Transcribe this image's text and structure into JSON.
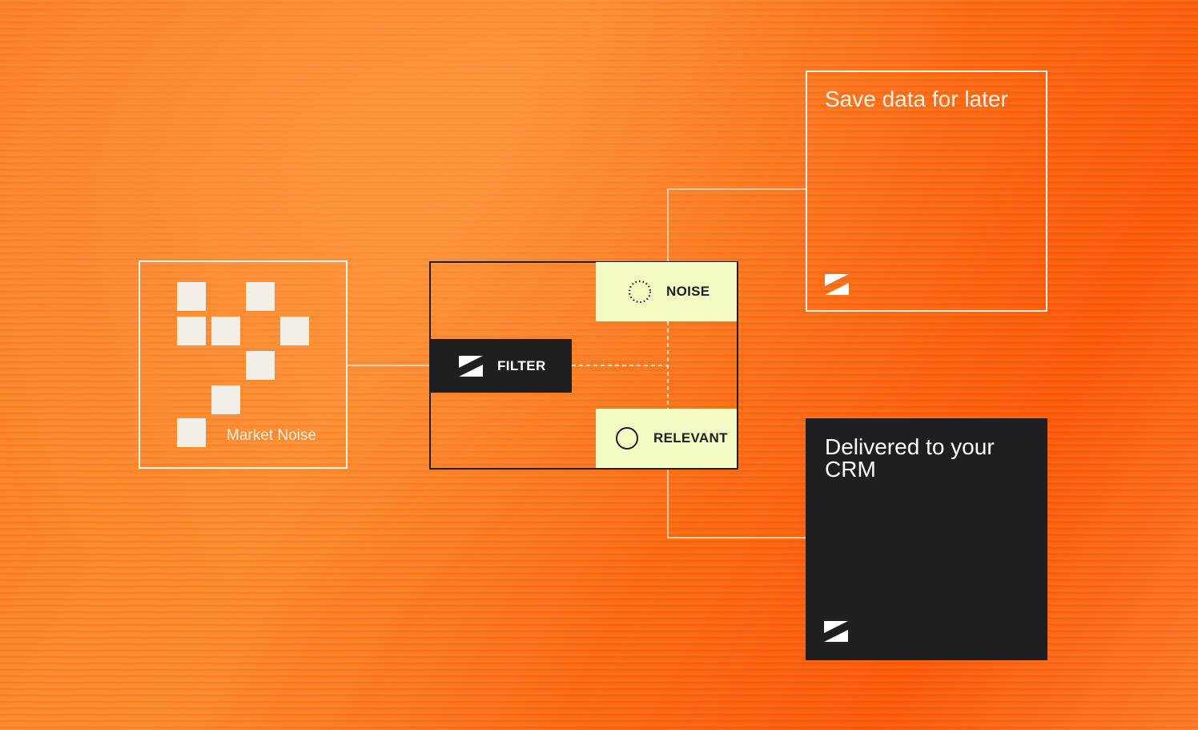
{
  "colors": {
    "background": "#ff7a1f",
    "dark": "#1f1f21",
    "pill": "#f5f9c4",
    "outline": "#ffffff",
    "square": "#f3eee6"
  },
  "source": {
    "label": "Market Noise"
  },
  "filter": {
    "label": "FILTER",
    "icon": "logo-icon"
  },
  "outputs": {
    "noise": {
      "label": "NOISE",
      "icon": "dotted-circle-icon"
    },
    "relevant": {
      "label": "RELEVANT",
      "icon": "circle-icon"
    }
  },
  "destinations": {
    "save": {
      "title": "Save data for later",
      "icon": "logo-icon"
    },
    "crm": {
      "title_line1": "Delivered to your",
      "title_line2": "CRM",
      "icon": "logo-icon"
    }
  }
}
